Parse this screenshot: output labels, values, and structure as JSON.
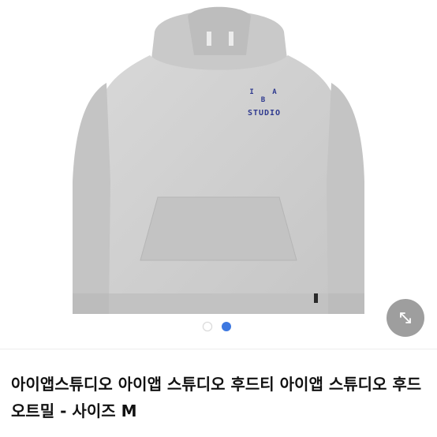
{
  "product": {
    "title": "아이앱스튜디오 아이앱 스튜디오 후드티 아이앱 스튜디오 후드 오트밀 - 사이즈 M",
    "print_top": "I A B",
    "print_bottom": "STUDIO"
  },
  "gallery": {
    "image_count": 2,
    "active_index": 2,
    "expand_icon": "expand-diagonal-icon"
  },
  "colors": {
    "garment": "#cfcfcf",
    "print": "#2f3a8f",
    "active_dot": "#3d78e0"
  }
}
